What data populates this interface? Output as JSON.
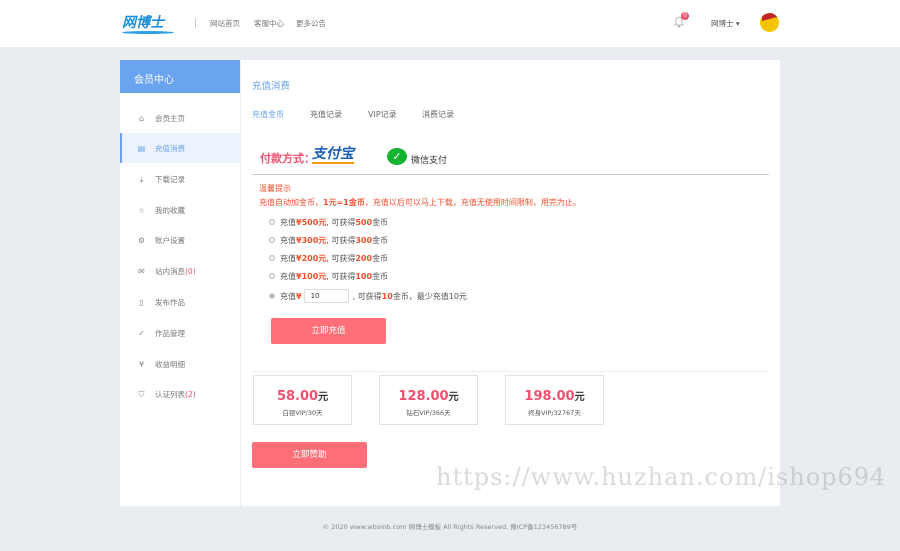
{
  "header": {
    "logo": "网博士",
    "nav": [
      "网站首页",
      "客服中心",
      "更多公告"
    ],
    "notification_count": "0",
    "username": "网博士 ▾"
  },
  "sidebar": {
    "title": "会员中心",
    "items": [
      {
        "label": "会员主页",
        "icon": "home-icon"
      },
      {
        "label": "充值消费",
        "icon": "bill-icon",
        "active": true
      },
      {
        "label": "下载记录",
        "icon": "download-icon"
      },
      {
        "label": "我的收藏",
        "icon": "star-icon"
      },
      {
        "label": "账户设置",
        "icon": "gear-icon"
      },
      {
        "label": "站内消息",
        "count": "(0)",
        "icon": "mail-icon"
      },
      {
        "label": "发布作品",
        "icon": "file-icon"
      },
      {
        "label": "作品管理",
        "icon": "check-circle-icon"
      },
      {
        "label": "收益明细",
        "icon": "yen-circle-icon"
      },
      {
        "label": "认证列表",
        "count": "(2)",
        "icon": "shield-icon"
      }
    ]
  },
  "main": {
    "title": "充值消费",
    "tabs": [
      "充值金币",
      "充值记录",
      "VIP记录",
      "消费记录"
    ],
    "pay_label": "付款方式：",
    "alipay": "支付宝",
    "wechat": "微信支付",
    "tip_title": "温馨提示",
    "tip_a": "充值自动加金币，",
    "tip_b": "1元=1金币",
    "tip_c": "，充值以后可以马上下载，充值无使用时间限制，用完为止。",
    "options": [
      {
        "pre": "充值 ",
        "price": "¥500元",
        "mid": ", 可获得 ",
        "coins": "500",
        "post": " 金币"
      },
      {
        "pre": "充值 ",
        "price": "¥300元",
        "mid": ", 可获得 ",
        "coins": "300",
        "post": " 金币"
      },
      {
        "pre": "充值 ",
        "price": "¥200元",
        "mid": ", 可获得 ",
        "coins": "200",
        "post": " 金币"
      },
      {
        "pre": "充值 ",
        "price": "¥100元",
        "mid": ", 可获得 ",
        "coins": "100",
        "post": " 金币"
      }
    ],
    "custom": {
      "pre": "充值 ",
      "yen": "¥",
      "value": "10",
      "mid": ", 可获得 ",
      "coins": "10",
      "post": " 金币，最少充值10元"
    },
    "recharge_button": "立即充值",
    "vip": [
      {
        "price": "58.00",
        "unit": "元",
        "desc": "白银VIP/30天"
      },
      {
        "price": "128.00",
        "unit": "元",
        "desc": "钻石VIP/366天"
      },
      {
        "price": "198.00",
        "unit": "元",
        "desc": "终身VIP/32767天"
      }
    ],
    "sponsor_button": "立即赞助"
  },
  "footer": "© 2020 www.wbsmb.com 网博士模板 All Rights Reserved. 豫ICP备123456789号",
  "watermark": "https://www.huzhan.com/ishop694",
  "colors": {
    "accent": "#6aa3ef",
    "button": "#ff6f78",
    "highlight": "#f0506e"
  }
}
